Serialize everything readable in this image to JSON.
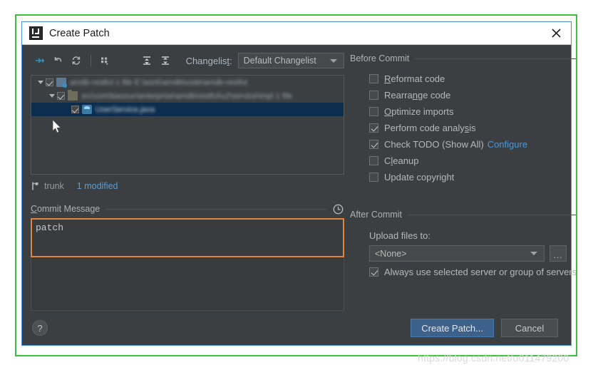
{
  "dialog": {
    "title": "Create Patch",
    "logo_icon": "intellij-idea-logo-icon",
    "close_icon": "close-icon"
  },
  "toolbar": {
    "buttons": [
      {
        "name": "show-diff-button",
        "icon": "show-diff-icon"
      },
      {
        "name": "revert-button",
        "icon": "revert-arrow-icon"
      },
      {
        "name": "refresh-button",
        "icon": "refresh-icon"
      },
      {
        "name": "group-by-button",
        "icon": "group-by-icon"
      },
      {
        "name": "expand-all-button",
        "icon": "expand-all-icon"
      },
      {
        "name": "collapse-all-button",
        "icon": "collapse-all-icon"
      }
    ],
    "changelist_label": "Changelis",
    "changelist_label_mnemonic": "t",
    "changelist_label_suffix": ":",
    "changelist_value": "Default Changelist"
  },
  "file_tree": {
    "rows": [
      {
        "indent": 0,
        "expanded": true,
        "checked": true,
        "icon": "module-icon",
        "label": "amdb-restful 1 file E:\\work\\amdb\\code\\amdb-restful",
        "blurred": true,
        "selected": false
      },
      {
        "indent": 1,
        "expanded": true,
        "checked": true,
        "icon": "folder-icon",
        "label": "src\\com\\baozun\\enterprise\\amdb\\restful\\u2\\service\\impl 1 file",
        "blurred": true,
        "selected": false
      },
      {
        "indent": 2,
        "expanded": false,
        "checked": true,
        "icon": "java-class-icon",
        "label": "UserService.java",
        "blurred": true,
        "selected": true
      }
    ]
  },
  "branch_bar": {
    "branch_icon": "branch-icon",
    "branch_name": "trunk",
    "modified_text": "1 modified"
  },
  "commit_message": {
    "label_prefix": "",
    "label_mnemonic": "C",
    "label_rest": "ommit Message",
    "history_icon": "clock-history-icon",
    "value": "patch",
    "border_color": "#e08440"
  },
  "before_commit": {
    "section_title": "Before Commit",
    "items": [
      {
        "name": "reformat-code",
        "pre": "",
        "mnemonic": "R",
        "post": "eformat code",
        "checked": false
      },
      {
        "name": "rearrange-code",
        "pre": "Rearra",
        "mnemonic": "n",
        "post": "ge code",
        "checked": false
      },
      {
        "name": "optimize-imports",
        "pre": "",
        "mnemonic": "O",
        "post": "ptimize imports",
        "checked": false
      },
      {
        "name": "perform-code-analysis",
        "pre": "Perform code analy",
        "mnemonic": "s",
        "post": "is",
        "checked": true
      },
      {
        "name": "check-todo",
        "pre": "Check TODO (Show All)",
        "mnemonic": "",
        "post": "",
        "checked": true,
        "link": "Configure"
      },
      {
        "name": "cleanup",
        "pre": "C",
        "mnemonic": "l",
        "post": "eanup",
        "checked": false
      },
      {
        "name": "update-copyright",
        "pre": "Update copyright",
        "mnemonic": "",
        "post": "",
        "checked": false
      }
    ]
  },
  "after_commit": {
    "section_title": "After Commit",
    "upload_label": "Upload files to:",
    "server_value": "<None>",
    "browse_label": "...",
    "always_use_label": "Always use selected server or group of servers",
    "always_use_checked": true
  },
  "bottom": {
    "help_label": "?",
    "create_patch_label": "Create Patch...",
    "cancel_label": "Cancel"
  },
  "watermark": {
    "text": "https://blog.csdn.net/u011479200"
  },
  "colors": {
    "accent_blue": "#4a90d9",
    "panel_bg": "#3c3f41",
    "selection_blue": "#0d2d4e",
    "link_blue": "#4e96d6",
    "highlight_orange": "#e08440",
    "frame_green": "#3fc03f"
  }
}
